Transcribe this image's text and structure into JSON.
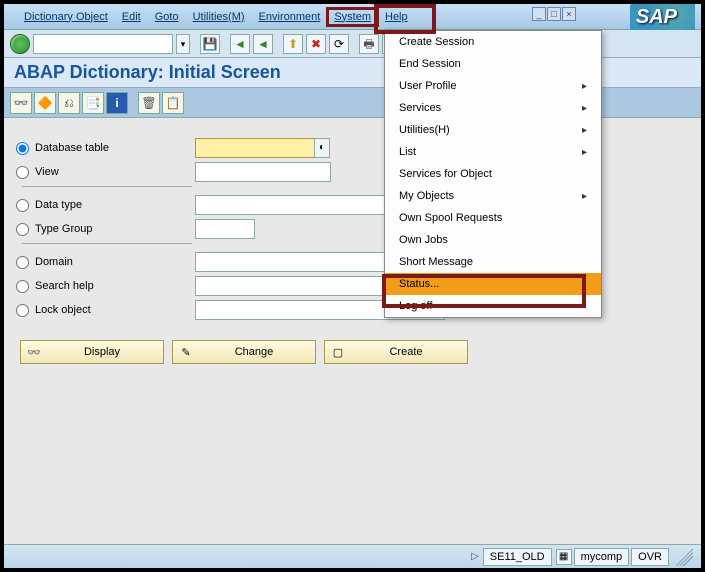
{
  "menu": {
    "items": [
      "Dictionary Object",
      "Edit",
      "Goto",
      "Utilities(M)",
      "Environment",
      "System",
      "Help"
    ]
  },
  "title": "ABAP Dictionary: Initial Screen",
  "radios": {
    "db_table": "Database table",
    "view": "View",
    "data_type": "Data type",
    "type_group": "Type Group",
    "domain": "Domain",
    "search_help": "Search help",
    "lock_object": "Lock object"
  },
  "inputs": {
    "db_table": "",
    "view": "",
    "data_type": "",
    "type_group": "",
    "domain": "",
    "search_help": "",
    "lock_object": ""
  },
  "buttons": {
    "display": "Display",
    "change": "Change",
    "create": "Create"
  },
  "dropdown": {
    "items": [
      {
        "label": "Create Session",
        "sub": ""
      },
      {
        "label": "End Session",
        "sub": ""
      },
      {
        "label": "User Profile",
        "sub": "▸"
      },
      {
        "label": "Services",
        "sub": "▸"
      },
      {
        "label": "Utilities(H)",
        "sub": "▸"
      },
      {
        "label": "List",
        "sub": "▸"
      },
      {
        "label": "Services for Object",
        "sub": ""
      },
      {
        "label": "My Objects",
        "sub": "▸"
      },
      {
        "label": "Own Spool Requests",
        "sub": ""
      },
      {
        "label": "Own Jobs",
        "sub": ""
      },
      {
        "label": "Short Message",
        "sub": ""
      },
      {
        "label": "Status...",
        "sub": ""
      },
      {
        "label": "Log off",
        "sub": ""
      }
    ],
    "highlighted": 11
  },
  "status": {
    "program": "SE11_OLD",
    "host": "mycomp",
    "ovr": "OVR"
  },
  "logo": "SAP"
}
